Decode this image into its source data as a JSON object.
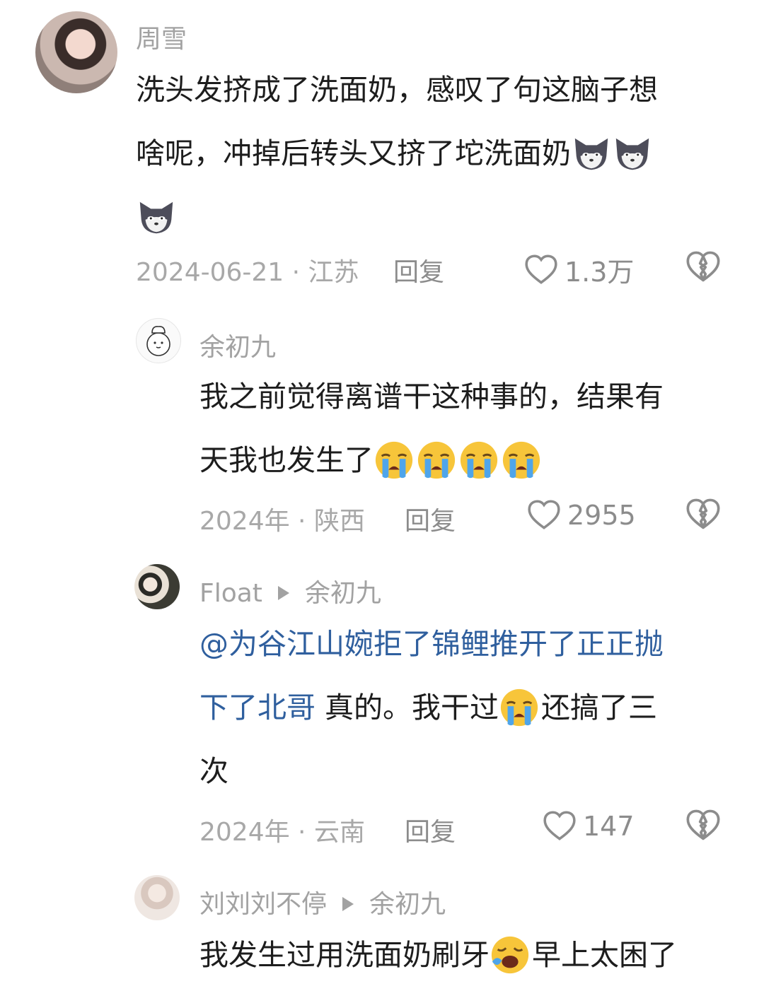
{
  "comments": [
    {
      "name": "周雪",
      "text_parts": [
        "洗头发挤成了洗面奶，感叹了句这脑子想",
        "啥呢，冲掉后转头又挤了坨洗面奶"
      ],
      "emoji": "wolf-emoji",
      "date": "2024-06-21 · 江苏",
      "reply_label": "回复",
      "likes": "1.3万"
    },
    {
      "name": "余初九",
      "text_parts": [
        "我之前觉得离谱干这种事的，结果有",
        "天我也发生了"
      ],
      "emoji": "crying-emoji",
      "date": "2024年 · 陕西",
      "reply_label": "回复",
      "likes": "2955"
    },
    {
      "name": "Float",
      "reply_to": "余初九",
      "mention_parts": [
        "@为谷江山婉拒了锦鲤推开了正正抛",
        "下了北哥"
      ],
      "text_parts": [
        " 真的。我干过",
        "还搞了三",
        "次"
      ],
      "date": "2024年 · 云南",
      "reply_label": "回复",
      "likes": "147"
    },
    {
      "name": "刘刘刘不停",
      "reply_to": "余初九",
      "text_parts": [
        "我发生过用洗面奶刷牙",
        "早上太困了"
      ],
      "emoji": "yawning-emoji"
    }
  ],
  "colors": {
    "mention": "#2f5f9e",
    "meta": "#a8a8a8",
    "text": "#1d1d1d"
  }
}
